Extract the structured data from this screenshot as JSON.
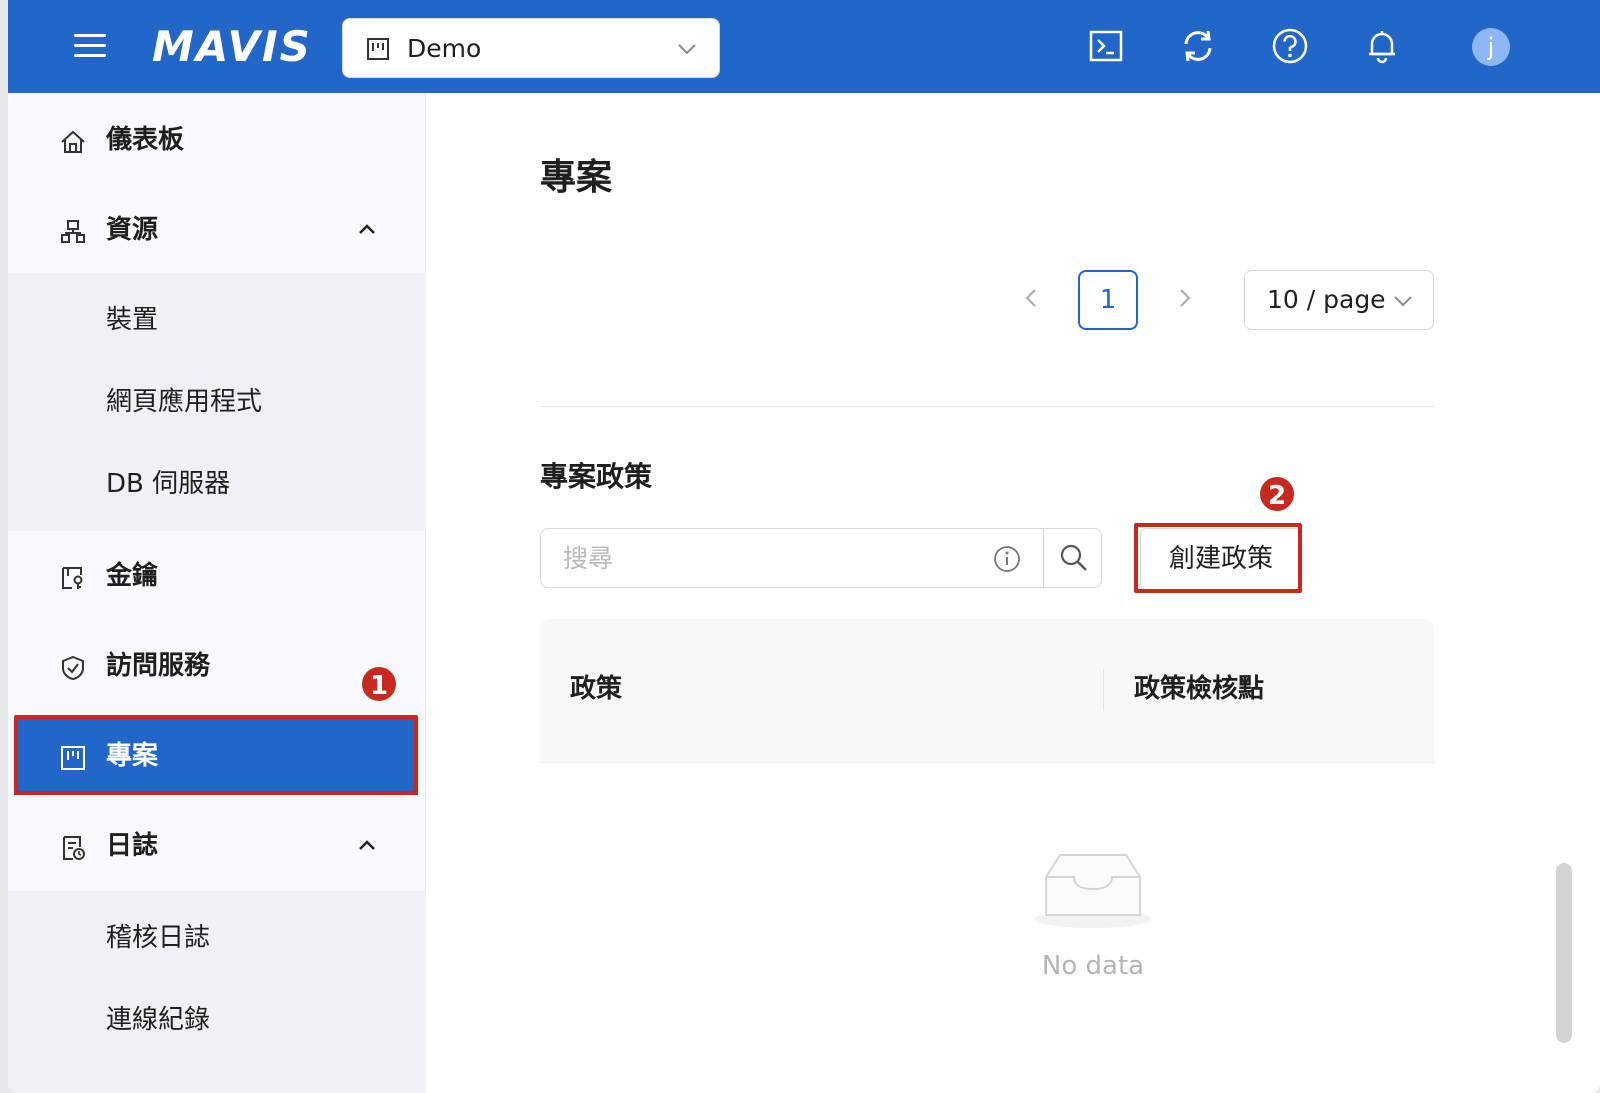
{
  "header": {
    "logo": "MAVIS",
    "project_select": {
      "value": "Demo"
    }
  },
  "sidebar": {
    "items": [
      {
        "label": "儀表板"
      },
      {
        "label": "資源",
        "children": [
          "裝置",
          "網頁應用程式",
          "DB 伺服器"
        ]
      },
      {
        "label": "金鑰"
      },
      {
        "label": "訪問服務"
      },
      {
        "label": "專案",
        "active": true
      },
      {
        "label": "日誌",
        "children": [
          "稽核日誌",
          "連線紀錄"
        ]
      }
    ]
  },
  "annotations": {
    "badge_1": "1",
    "badge_2": "2",
    "highlight_color": "#c8291e"
  },
  "main": {
    "title": "專案",
    "pagination": {
      "current_page": "1",
      "page_size": "10 / page"
    },
    "policy_section": {
      "title": "專案政策",
      "search_placeholder": "搜尋",
      "create_button": "創建政策",
      "columns": [
        "政策",
        "政策檢核點"
      ],
      "empty_text": "No data"
    }
  },
  "colors": {
    "brand": "#2266c7",
    "sidebar_bg": "#f6f9fd"
  }
}
